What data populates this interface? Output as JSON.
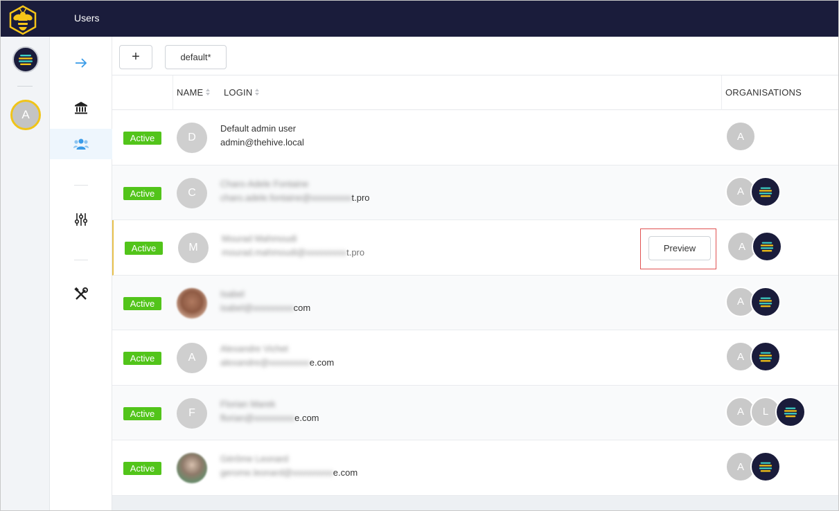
{
  "app": {
    "section_title": "Users"
  },
  "toolbar": {
    "add_label": "+",
    "filter_label": "default*"
  },
  "rail": {
    "current_user_initial": "A"
  },
  "table": {
    "columns": {
      "name": "NAME",
      "login": "LOGIN",
      "organisations": "ORGANISATIONS"
    },
    "rows": [
      {
        "status": "Active",
        "initial": "D",
        "photo": false,
        "name": "Default admin user",
        "login": "admin@thehive.local",
        "login_blurred": "",
        "login_suffix": "",
        "name_blurred": false,
        "orgs": [
          "A"
        ],
        "hive_org": false
      },
      {
        "status": "Active",
        "initial": "C",
        "photo": false,
        "name": "Charo-Adele Fontaine",
        "login": "",
        "login_blurred": "charo.adele.fontaine@xxxxxxxxx",
        "login_suffix": "t.pro",
        "name_blurred": true,
        "orgs": [
          "A"
        ],
        "hive_org": true
      },
      {
        "status": "Active",
        "initial": "M",
        "photo": false,
        "name": "Mourad Mahmoudi",
        "login": "",
        "login_blurred": "mourad.mahmoudi@xxxxxxxxx",
        "login_suffix": "t.pro",
        "name_blurred": true,
        "orgs": [
          "A"
        ],
        "hive_org": true,
        "preview_label": "Preview"
      },
      {
        "status": "Active",
        "initial": "",
        "photo": true,
        "name": "Isabel",
        "login": "",
        "login_blurred": "isabel@xxxxxxxxx",
        "login_suffix": "com",
        "name_blurred": true,
        "orgs": [
          "A"
        ],
        "hive_org": true
      },
      {
        "status": "Active",
        "initial": "A",
        "photo": false,
        "name": "Alexandre Vichet",
        "login": "",
        "login_blurred": "alexandre@xxxxxxxxx",
        "login_suffix": "e.com",
        "name_blurred": true,
        "orgs": [
          "A"
        ],
        "hive_org": true
      },
      {
        "status": "Active",
        "initial": "F",
        "photo": false,
        "name": "Florian Marek",
        "login": "",
        "login_blurred": "florian@xxxxxxxxx",
        "login_suffix": "e.com",
        "name_blurred": true,
        "orgs": [
          "A",
          "L"
        ],
        "hive_org": true
      },
      {
        "status": "Active",
        "initial": "",
        "photo": true,
        "name": "Gérôme Leonard",
        "login": "",
        "login_blurred": "gerome.leonard@xxxxxxxxx",
        "login_suffix": "e.com",
        "name_blurred": true,
        "orgs": [
          "A"
        ],
        "hive_org": true
      }
    ]
  },
  "colors": {
    "topbar": "#1a1c3b",
    "active_badge": "#52c41a",
    "accent_yellow": "#f0c419",
    "hive_teal": "#3fd3c6",
    "hive_yellow": "#f5c518"
  },
  "icons": {
    "logo": "bee-logo-icon",
    "menu": [
      "arrow-right-icon",
      "bank-icon",
      "users-icon",
      "sliders-icon",
      "tools-icon"
    ]
  }
}
